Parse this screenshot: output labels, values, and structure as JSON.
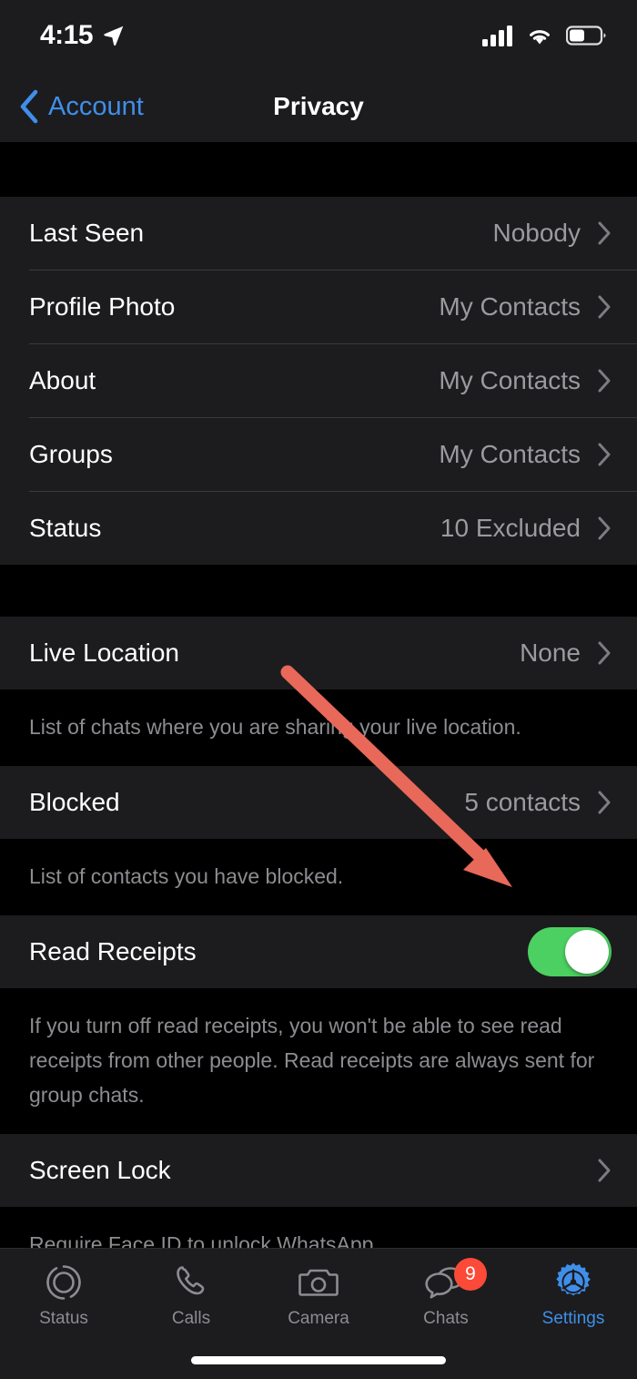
{
  "status_bar": {
    "time": "4:15",
    "location_icon": "location-arrow-icon",
    "signal_icon": "cellular-signal-icon",
    "wifi_icon": "wifi-icon",
    "battery_icon": "battery-icon"
  },
  "nav": {
    "back_label": "Account",
    "back_icon": "chevron-left-icon",
    "title": "Privacy"
  },
  "group1": [
    {
      "label": "Last Seen",
      "value": "Nobody"
    },
    {
      "label": "Profile Photo",
      "value": "My Contacts"
    },
    {
      "label": "About",
      "value": "My Contacts"
    },
    {
      "label": "Groups",
      "value": "My Contacts"
    },
    {
      "label": "Status",
      "value": "10 Excluded"
    }
  ],
  "live_location": {
    "label": "Live Location",
    "value": "None",
    "footer": "List of chats where you are sharing your live location."
  },
  "blocked": {
    "label": "Blocked",
    "value": "5 contacts",
    "footer": "List of contacts you have blocked."
  },
  "read_receipts": {
    "label": "Read Receipts",
    "toggle_state": "on",
    "footer": "If you turn off read receipts, you won't be able to see read receipts from other people. Read receipts are always sent for group chats."
  },
  "screen_lock": {
    "label": "Screen Lock",
    "footer": "Require Face ID to unlock WhatsApp."
  },
  "tabbar": [
    {
      "label": "Status",
      "icon": "status-rings-icon",
      "active": false,
      "badge": ""
    },
    {
      "label": "Calls",
      "icon": "phone-icon",
      "active": false,
      "badge": ""
    },
    {
      "label": "Camera",
      "icon": "camera-icon",
      "active": false,
      "badge": ""
    },
    {
      "label": "Chats",
      "icon": "chat-bubbles-icon",
      "active": false,
      "badge": "9"
    },
    {
      "label": "Settings",
      "icon": "gear-icon",
      "active": true,
      "badge": ""
    }
  ],
  "colors": {
    "accent_blue": "#3F8FEA",
    "toggle_green": "#4CD061",
    "badge_red": "#FB4A38",
    "annotation_red": "#E8685A",
    "row_bg": "#1C1C1E",
    "page_bg": "#000000",
    "secondary_text": "#8C8C91"
  }
}
